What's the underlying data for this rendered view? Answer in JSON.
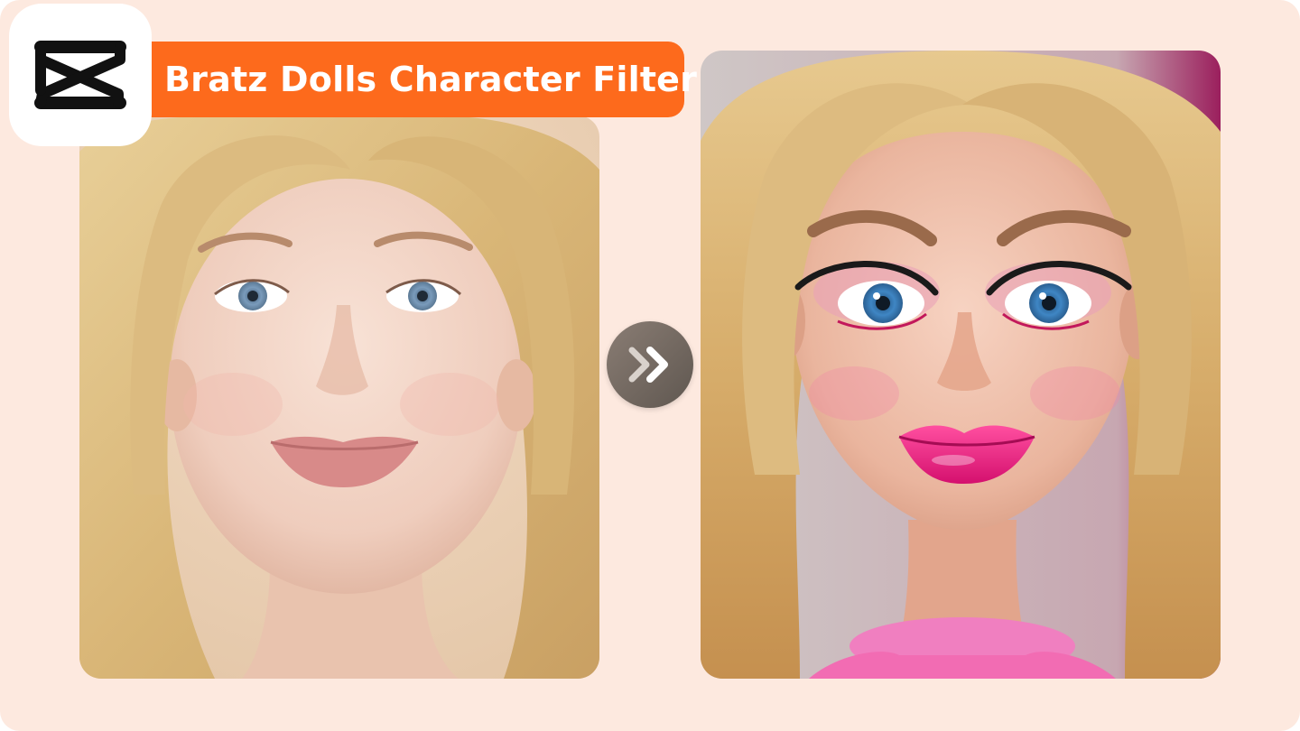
{
  "banner": {
    "title": "Bratz Dolls Character Filter"
  },
  "logo": {
    "icon": "capcut-logo-icon",
    "tile_color": "#ffffff",
    "mark_color": "#111111"
  },
  "comparison": {
    "before_image": "original-portrait-photo",
    "after_image": "bratz-doll-filtered-portrait",
    "arrow_icon": "double-chevron-right-icon"
  },
  "colors": {
    "background": "#fde9df",
    "banner": "#fd6a1c",
    "banner_text": "#ffffff",
    "arrow_button": "#6f665f"
  }
}
